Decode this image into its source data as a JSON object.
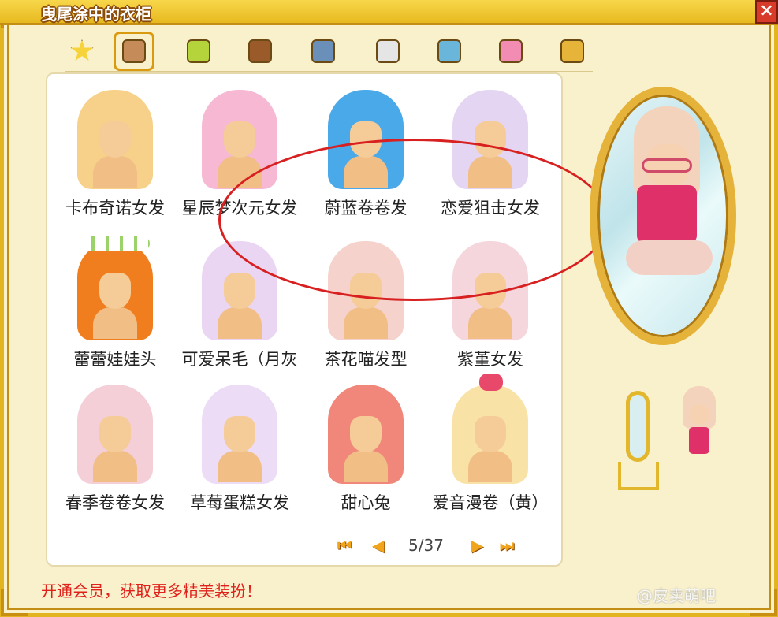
{
  "window": {
    "title": "曳尾涂中的衣柜",
    "close_label": "×"
  },
  "tabs": [
    {
      "icon": "star-icon",
      "color": "#f6d33a"
    },
    {
      "icon": "hair-icon",
      "color": "#c58b59",
      "active": true
    },
    {
      "icon": "shirt-icon",
      "color": "#b5d33a"
    },
    {
      "icon": "coat-icon",
      "color": "#9b5a2a"
    },
    {
      "icon": "pants-icon",
      "color": "#6a8fb8"
    },
    {
      "icon": "glasses-icon",
      "color": "#e5e5e5"
    },
    {
      "icon": "hat-icon",
      "color": "#6ab6da"
    },
    {
      "icon": "bow-icon",
      "color": "#f28cb3"
    },
    {
      "icon": "suit-icon",
      "color": "#e7b43a"
    }
  ],
  "items": [
    {
      "name": "卡布奇诺女发",
      "color": "#f7d18a",
      "accent": null
    },
    {
      "name": "星辰梦次元女发",
      "color": "#f6b8d2",
      "accent": null
    },
    {
      "name": "蔚蓝卷卷发",
      "color": "#4aa9e8",
      "accent": null
    },
    {
      "name": "恋爱狙击女发",
      "color": "#e4d6f2",
      "accent": null
    },
    {
      "name": "蕾蕾娃娃头",
      "color": "#f07e1e",
      "accent": "flowers"
    },
    {
      "name": "可爱呆毛（月灰",
      "color": "#ead6f2",
      "accent": null
    },
    {
      "name": "茶花喵发型",
      "color": "#f5d2cc",
      "accent": null
    },
    {
      "name": "紫堇女发",
      "color": "#f5d6dc",
      "accent": null
    },
    {
      "name": "春季卷卷女发",
      "color": "#f4cfd8",
      "accent": null
    },
    {
      "name": "草莓蛋糕女发",
      "color": "#ecdcf6",
      "accent": null
    },
    {
      "name": "甜心兔",
      "color": "#f0877a",
      "accent": null
    },
    {
      "name": "爱音漫卷（黄）",
      "color": "#f9e2a6",
      "accent": "bow"
    }
  ],
  "pagination": {
    "first": "⏮",
    "prev": "◀",
    "current": "5/37",
    "next": "▶",
    "last": "⏭"
  },
  "promo": "开通会员，获取更多精美装扮！",
  "watermark": "@皮卖萌吧"
}
